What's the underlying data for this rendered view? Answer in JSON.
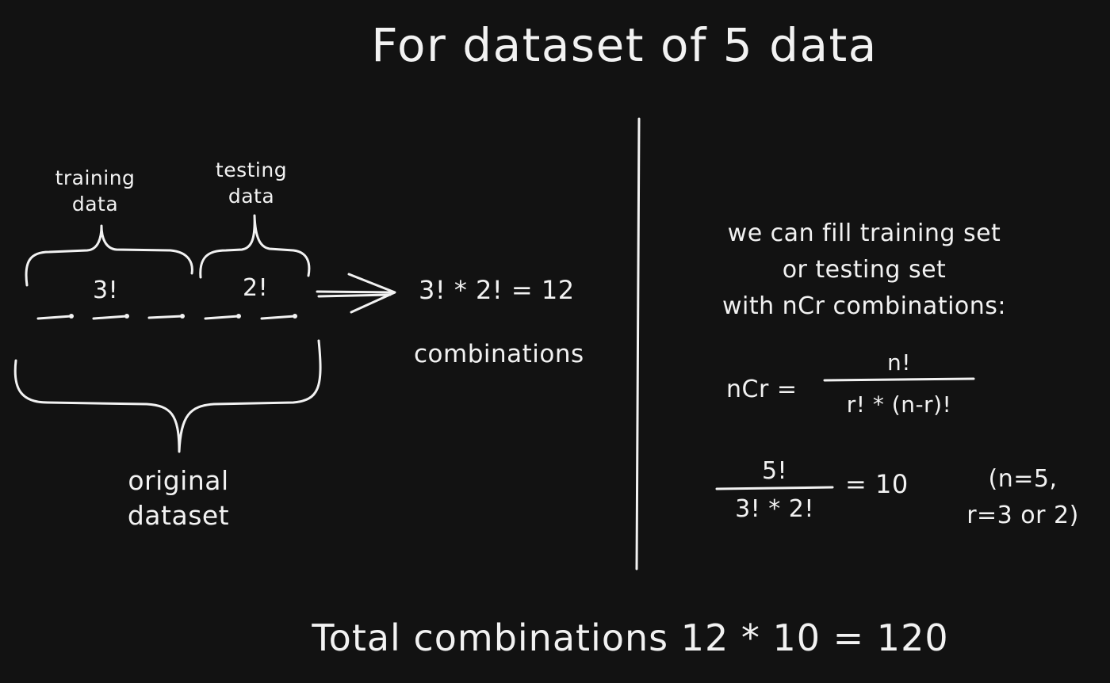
{
  "title": "For dataset of 5 data",
  "left": {
    "training_label": [
      "training",
      "data"
    ],
    "testing_label": [
      "testing",
      "data"
    ],
    "training_value": "3!",
    "testing_value": "2!",
    "original_label": [
      "original",
      "dataset"
    ],
    "result_equation": "3! * 2! = 12",
    "result_caption": "combinations"
  },
  "right": {
    "description": [
      "we can fill training set",
      "or testing set",
      "with nCr combinations:"
    ],
    "formula_lhs": "nCr =",
    "formula_numerator": "n!",
    "formula_denominator": "r! * (n-r)!",
    "example_numerator": "5!",
    "example_denominator": "3! * 2!",
    "example_result": "= 10",
    "example_params": [
      "(n=5,",
      "r=3 or 2)"
    ]
  },
  "footer": "Total combinations 12 * 10 = 120"
}
